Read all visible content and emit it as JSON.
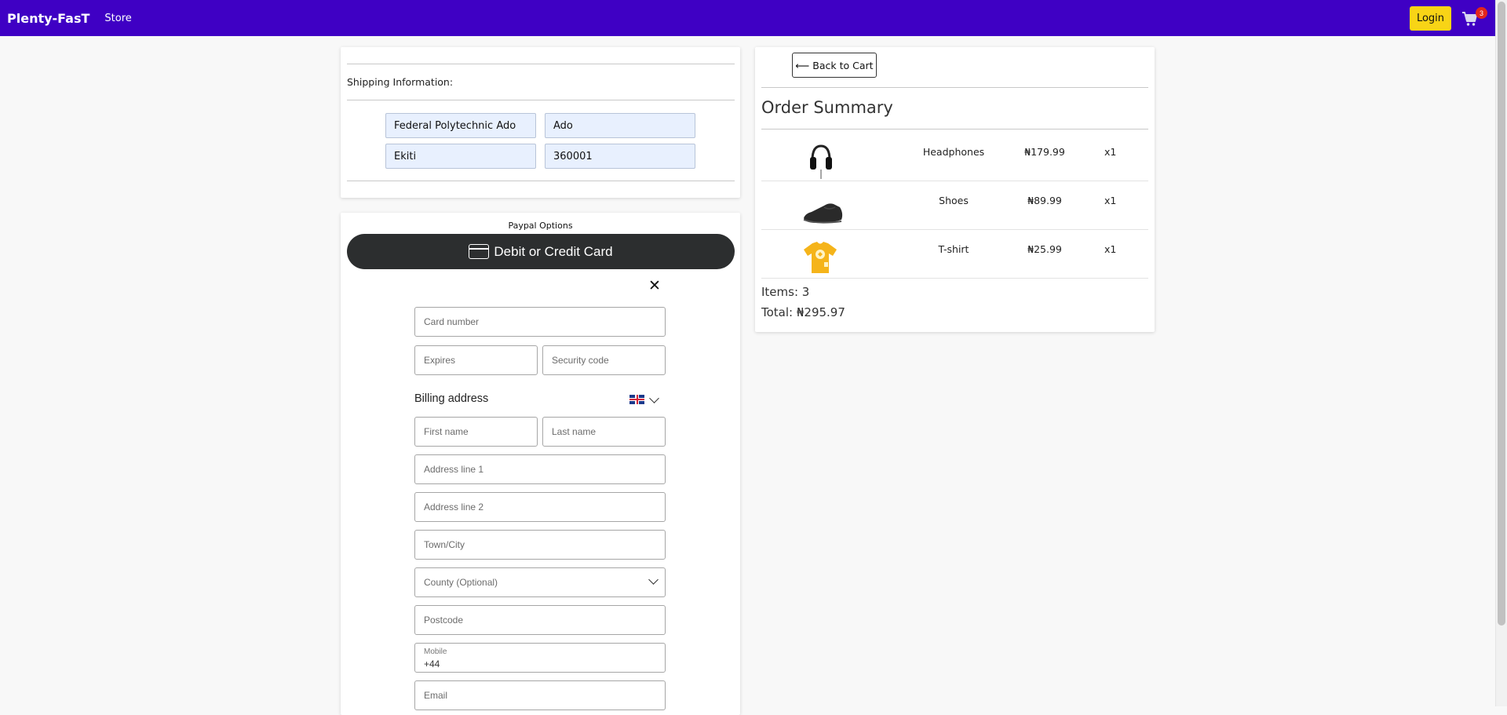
{
  "navbar": {
    "brand": "Plenty-FasT",
    "store_link": "Store",
    "login_label": "Login",
    "cart_count": "3",
    "cart_icon": "cart-icon",
    "bg_color": "#3f00c4",
    "login_color": "#f8d416"
  },
  "shipping": {
    "label": "Shipping Information:",
    "address": "Federal Polytechnic Ado",
    "city": "Ado",
    "state": "Ekiti",
    "zip": "360001"
  },
  "payment": {
    "title": "Paypal Options",
    "debit_label": "Debit or Credit Card",
    "debit_icon": "credit-card-icon",
    "close_icon": "close-icon",
    "card_number_placeholder": "Card number",
    "expires_placeholder": "Expires",
    "security_placeholder": "Security code",
    "billing_label": "Billing address",
    "country_flag_icon": "uk-flag-icon",
    "first_name_placeholder": "First name",
    "last_name_placeholder": "Last name",
    "address1_placeholder": "Address line 1",
    "address2_placeholder": "Address line 2",
    "town_placeholder": "Town/City",
    "county_placeholder": "County (Optional)",
    "postcode_placeholder": "Postcode",
    "mobile_label": "Mobile",
    "mobile_value": "+44",
    "email_placeholder": "Email",
    "button_color": "#2c2e2f"
  },
  "order": {
    "back_label": "⟵ Back to Cart",
    "title": "Order Summary",
    "items": [
      {
        "name": "Headphones",
        "price": "₦179.99",
        "qty": "x1",
        "icon": "headphones-image"
      },
      {
        "name": "Shoes",
        "price": "₦89.99",
        "qty": "x1",
        "icon": "shoes-image"
      },
      {
        "name": "T-shirt",
        "price": "₦25.99",
        "qty": "x1",
        "icon": "tshirt-image"
      }
    ],
    "items_count": "Items: 3",
    "total": "Total: ₦295.97"
  }
}
